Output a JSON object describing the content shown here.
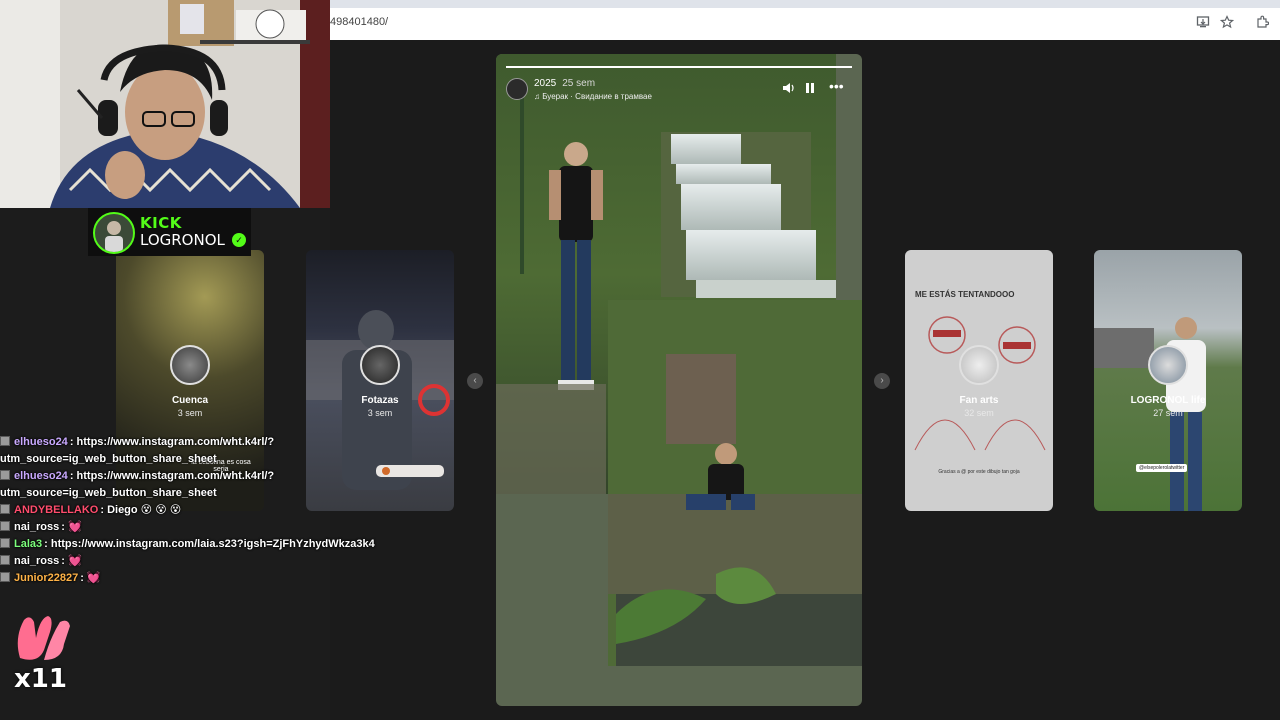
{
  "browser": {
    "url_fragment": "498401480/"
  },
  "stories_left": [
    {
      "name": "Cuenca",
      "time": "3 sem",
      "overlay_text": "la cebolina es cosa seria"
    },
    {
      "name": "Fotazas",
      "time": "3 sem"
    }
  ],
  "stories_right": [
    {
      "name": "Fan arts",
      "time": "32 sem",
      "overlay_title": "ME ESTÁS TENTANDOOO",
      "overlay_caption": "Gracias a @ por este dibujo tan goja"
    },
    {
      "name": "LOGRONOL life",
      "time": "27 sem",
      "overlay_tag": "@elsepolerolatwitter"
    }
  ],
  "main_story": {
    "date": "2025",
    "ago": "25 sem",
    "music": "♫ Буерак · Свидание в трамвае",
    "progress": 1.0
  },
  "stream_overlay": {
    "platform_logo": "KICK",
    "channel": "LOGRONOL",
    "brand_color": "#53fc18"
  },
  "chat": [
    {
      "user": "elhueso24",
      "user_color": "#c9a9ff",
      "message": ": https://www.instagram.com/wht.k4rl/?",
      "message2": "utm_source=ig_web_button_share_sheet"
    },
    {
      "user": "elhueso24",
      "user_color": "#c9a9ff",
      "message": ": https://www.instagram.com/wht.k4rl/?",
      "message2": "utm_source=ig_web_button_share_sheet"
    },
    {
      "user": "ANDYBELLAKO",
      "user_color": "#ff4d6d",
      "message": ": Diego 😵 😵 😵"
    },
    {
      "user": "nai_ross",
      "user_color": "#ffffff",
      "message": ": 💓"
    },
    {
      "user": "Lala3",
      "user_color": "#7dff7d",
      "message": ": https://www.instagram.com/laia.s23?igsh=ZjFhYzhydWkza3k4"
    },
    {
      "user": "nai_ross",
      "user_color": "#ffffff",
      "message": ": 💓"
    },
    {
      "user": "Junior22827",
      "user_color": "#ffb347",
      "message": ": 💓"
    }
  ],
  "chat_multiplier": "x11"
}
